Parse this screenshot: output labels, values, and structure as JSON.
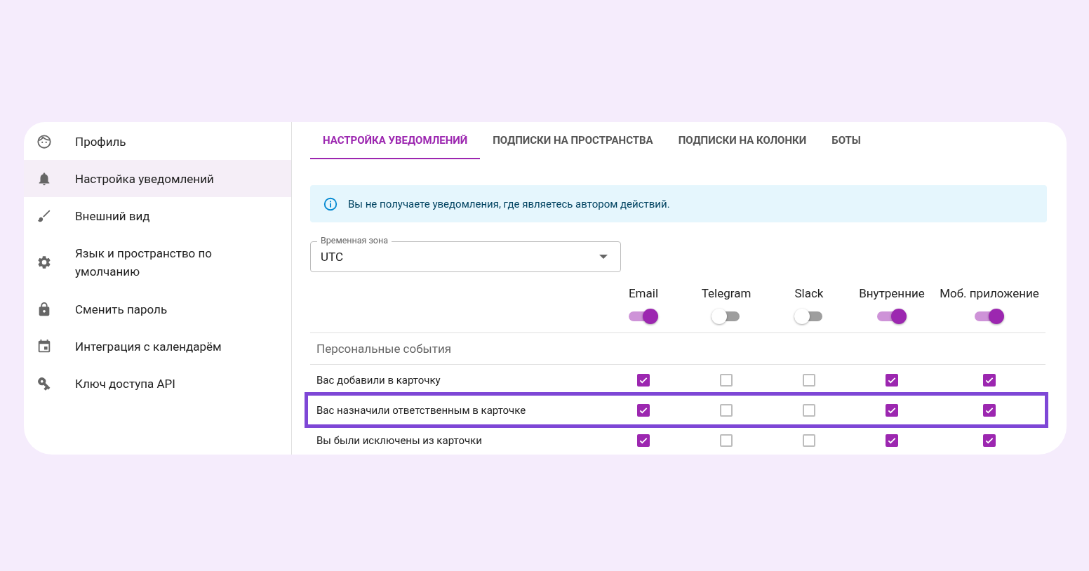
{
  "sidebar": {
    "items": [
      {
        "label": "Профиль",
        "selected": false
      },
      {
        "label": "Настройка уведомлений",
        "selected": true
      },
      {
        "label": "Внешний вид",
        "selected": false
      },
      {
        "label": "Язык и пространство по умолчанию",
        "selected": false
      },
      {
        "label": "Сменить пароль",
        "selected": false
      },
      {
        "label": "Интеграция с календарём",
        "selected": false
      },
      {
        "label": "Ключ доступа API",
        "selected": false
      }
    ]
  },
  "tabs": [
    {
      "label": "НАСТРОЙКА УВЕДОМЛЕНИЙ",
      "selected": true
    },
    {
      "label": "ПОДПИСКИ НА ПРОСТРАНСТВА",
      "selected": false
    },
    {
      "label": "ПОДПИСКИ НА КОЛОНКИ",
      "selected": false
    },
    {
      "label": "БОТЫ",
      "selected": false
    }
  ],
  "info_alert": {
    "text": "Вы не получаете уведомления, где являетесь автором действий."
  },
  "timezone_select": {
    "label": "Временная зона",
    "value": "UTC"
  },
  "channels": [
    {
      "name": "Email",
      "on": true
    },
    {
      "name": "Telegram",
      "on": false
    },
    {
      "name": "Slack",
      "on": false
    },
    {
      "name": "Внутренние",
      "on": true
    },
    {
      "name": "Моб. приложение",
      "on": true
    }
  ],
  "section": {
    "title": "Персональные события"
  },
  "rows": [
    {
      "label": "Вас добавили в карточку",
      "highlighted": false,
      "checks": [
        true,
        false,
        false,
        true,
        true
      ]
    },
    {
      "label": "Вас назначили ответственным в карточке",
      "highlighted": true,
      "checks": [
        true,
        false,
        false,
        true,
        true
      ]
    },
    {
      "label": "Вы были исключены из карточки",
      "highlighted": false,
      "checks": [
        true,
        false,
        false,
        true,
        true
      ]
    }
  ]
}
